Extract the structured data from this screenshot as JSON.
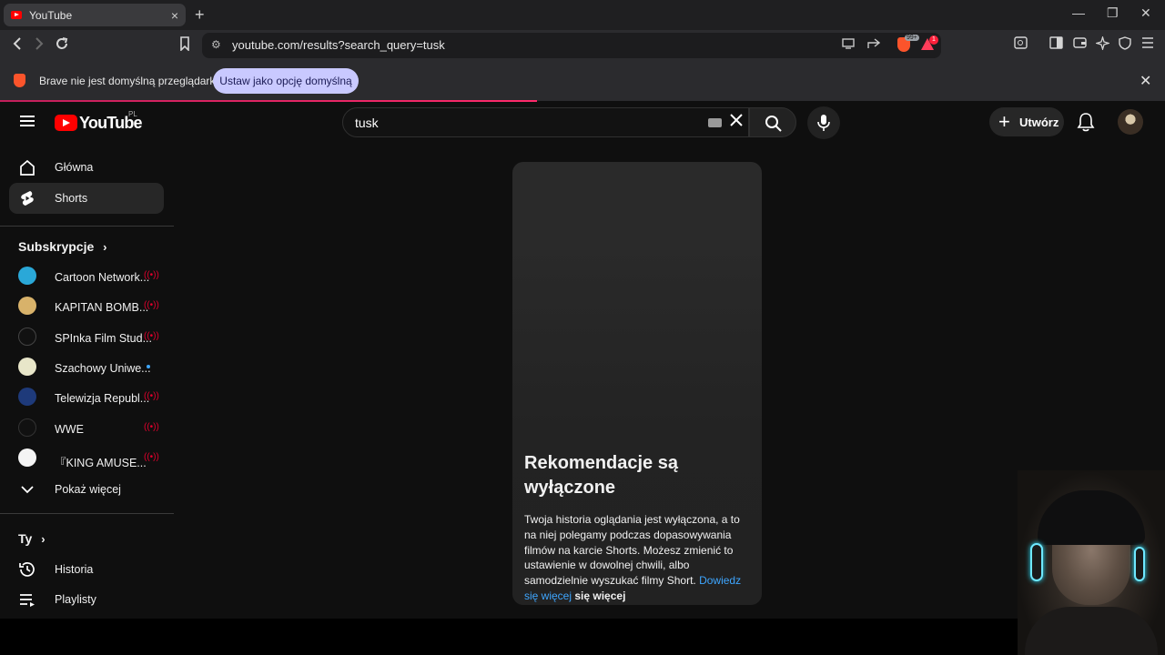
{
  "browser": {
    "tab_title": "YouTube",
    "tab_close": "×",
    "new_tab": "+",
    "window_min": "—",
    "window_restore": "❐",
    "window_close": "✕",
    "url": "youtube.com/results?search_query=tusk",
    "brave_badge_count": "99+",
    "rewards_badge": "1"
  },
  "infobar": {
    "message": "Brave nie jest domyślną przeglądarką",
    "button": "Ustaw jako opcję domyślną",
    "close": "✕"
  },
  "youtube": {
    "logo_text": "YouTube",
    "country": "PL",
    "search_query": "tusk",
    "create_label": "Utwórz"
  },
  "sidebar": {
    "home": "Główna",
    "shorts": "Shorts",
    "subscriptions_title": "Subskrypcje",
    "channels": [
      {
        "name": "Cartoon Network...",
        "color": "#2aa8d8",
        "status": "live"
      },
      {
        "name": "KAPITAN BOMB...",
        "color": "#d8b26a",
        "status": "live"
      },
      {
        "name": "SPInka Film Stud...",
        "color": "#111111",
        "status": "live"
      },
      {
        "name": "Szachowy Uniwe...",
        "color": "#e8e6c9",
        "status": "new"
      },
      {
        "name": "Telewizja Republ...",
        "color": "#1e3a7a",
        "status": "live"
      },
      {
        "name": "WWE",
        "color": "#111111",
        "status": "live"
      },
      {
        "name": "『KING AMUSE...",
        "color": "#f4f4f4",
        "status": "live"
      }
    ],
    "show_more": "Pokaż więcej",
    "you_title": "Ty",
    "history": "Historia",
    "playlists": "Playlisty"
  },
  "card": {
    "title": "Rekomendacje są wyłączone",
    "body": "Twoja historia oglądania jest wyłączona, a to na niej polegamy podczas dopasowywania filmów na karcie Shorts. Możesz zmienić to ustawienie w dowolnej chwili, albo samodzielnie wyszukać filmy Short.",
    "link": "Dowiedz się więcej",
    "link_suffix": "się więcej"
  }
}
